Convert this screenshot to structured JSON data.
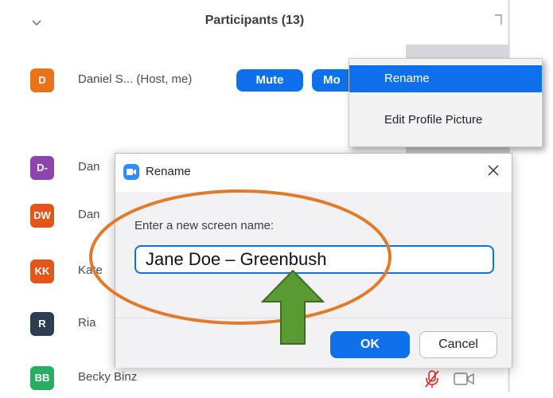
{
  "panel": {
    "title": "Participants (13)"
  },
  "participants": [
    {
      "initials": "D",
      "name": "Daniel S... (Host, me)",
      "color": "#e8731a"
    },
    {
      "initials": "D-",
      "name": "Dan",
      "color": "#8e44ad"
    },
    {
      "initials": "DW",
      "name": "Dan",
      "color": "#e0561b"
    },
    {
      "initials": "KK",
      "name": "Kate",
      "color": "#e0561b"
    },
    {
      "initials": "R",
      "name": "Ria",
      "color": "#2c3e50"
    },
    {
      "initials": "BB",
      "name": "Becky Binz",
      "color": "#27ae60"
    }
  ],
  "host_actions": {
    "mute_label": "Mute",
    "more_label": "Mo"
  },
  "context_menu": {
    "items": [
      "Rename",
      "Edit Profile Picture"
    ]
  },
  "dialog": {
    "title": "Rename",
    "prompt": "Enter a new screen name:",
    "input_value": "Jane Doe – Greenbush",
    "ok_label": "OK",
    "cancel_label": "Cancel"
  },
  "colors": {
    "accent": "#0e71eb",
    "annotation_ellipse": "#e07b2a",
    "annotation_arrow": "#5a9a32"
  }
}
